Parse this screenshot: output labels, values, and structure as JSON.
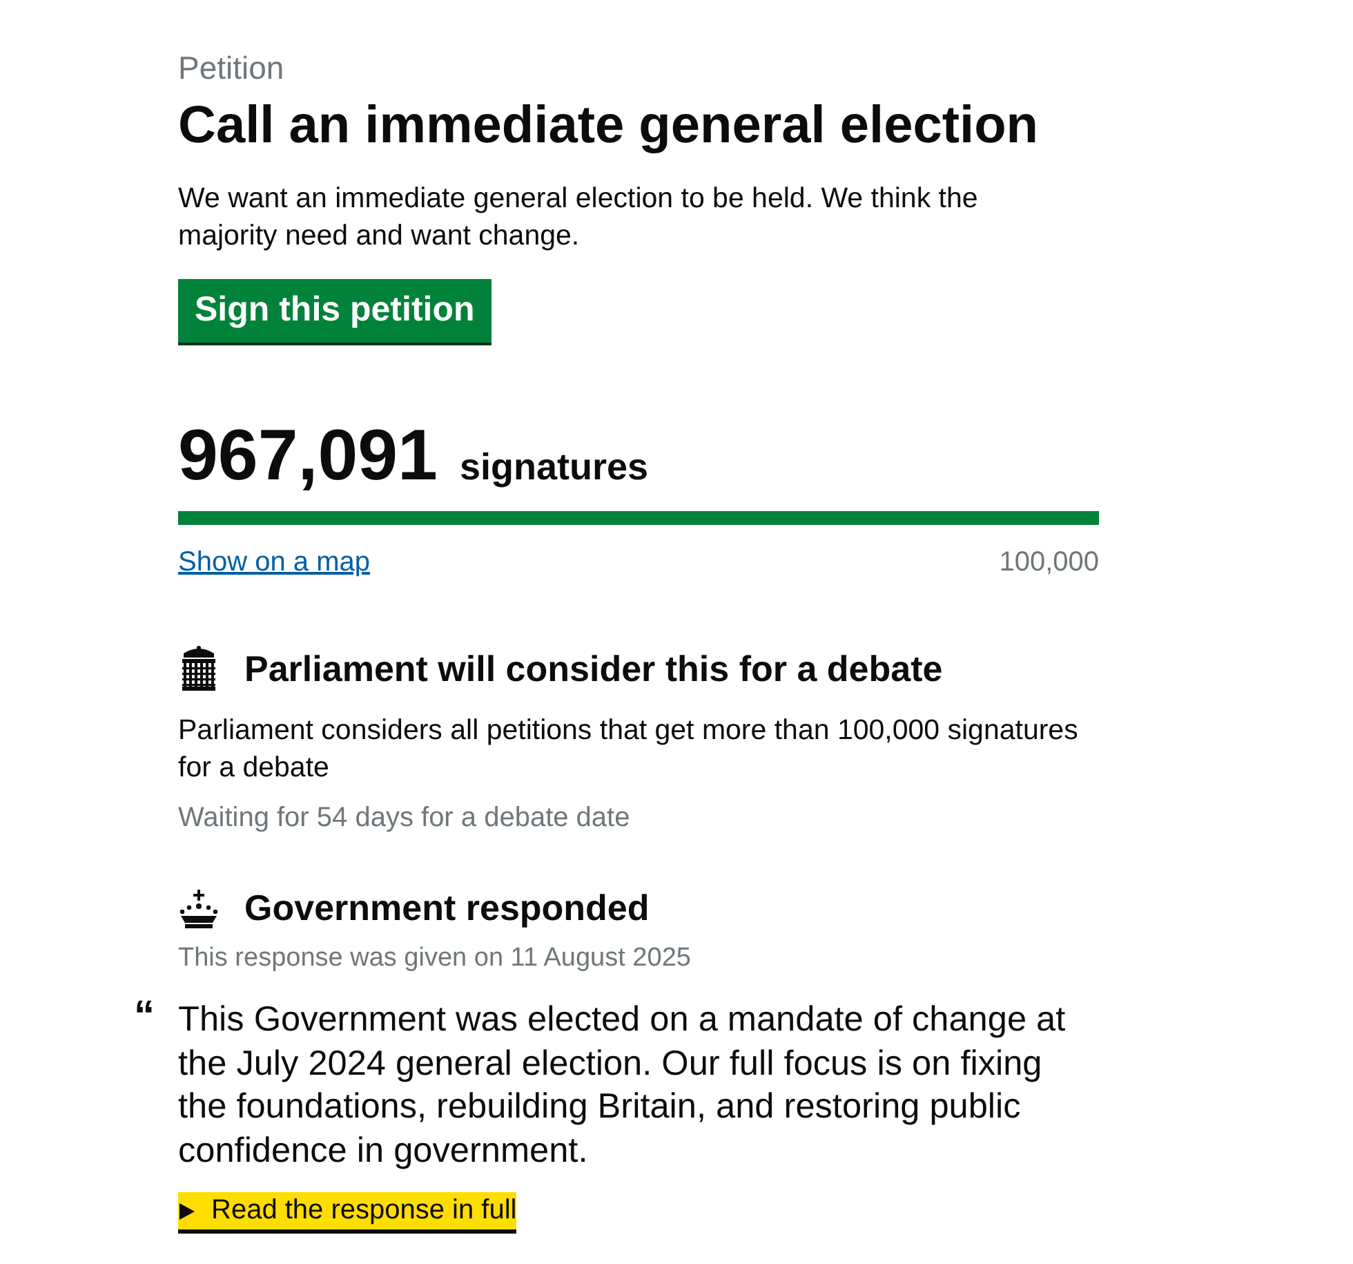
{
  "caption": "Petition",
  "title": "Call an immediate general election",
  "summary": "We want an immediate general election to be held. We think the majority need and want change.",
  "sign_button": "Sign this petition",
  "signatures": {
    "count": "967,091",
    "label": "signatures",
    "level": 1,
    "map_link": "Show on a map",
    "threshold": "100,000"
  },
  "sections": [
    {
      "kind": "parliament",
      "heading": "Parliament will consider this for a debate",
      "text": "Parliament considers all petitions that get more than 100,000 signatures for a debate",
      "note": "Waiting for 54 days for a debate date"
    },
    {
      "kind": "government",
      "heading": "Government responded",
      "note": "This response was given on 11 August 2025"
    }
  ],
  "response": {
    "quote_mark": "“",
    "text": "This Government was elected on a mandate of change at the July 2024 general election. Our full focus is on fixing the foundations, rebuilding Britain, and restoring public confidence in government.",
    "toggle": {
      "label": "Read the response in full",
      "expanded": false
    }
  }
}
